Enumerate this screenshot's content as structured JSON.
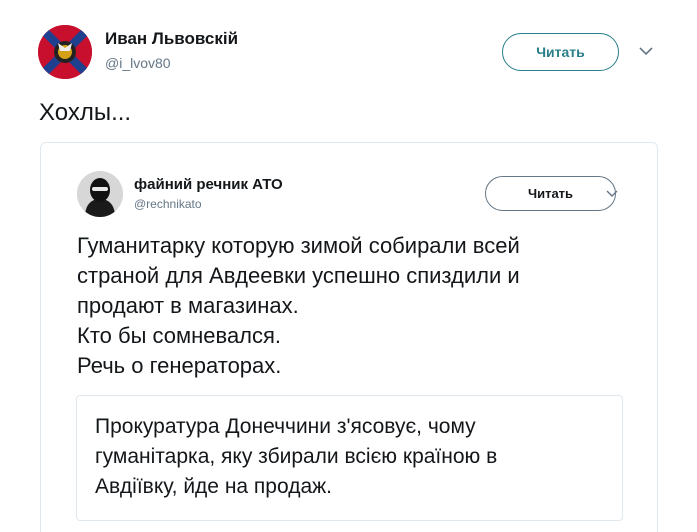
{
  "tweet": {
    "author_name": "Иван Львовскій",
    "author_handle": "@i_lvov80",
    "follow_label": "Читать",
    "text": "Хохлы..."
  },
  "quoted_tweet": {
    "author_name": "файний речник АТО",
    "author_handle": "@rechnikato",
    "follow_label": "Читать",
    "text_lines": [
      "Гуманитарку которую зимой собирали всей",
      "страной для Авдеевки успешно спиздили и",
      "продают в магазинах.",
      "Кто бы сомневался.",
      "Речь о генераторах."
    ],
    "link_card": {
      "title_lines": [
        "Прокуратура Донеччини з'ясовує, чому",
        "гуманітарка, яку збирали всією країною в",
        "Авдіївку, йде на продаж."
      ]
    }
  },
  "colors": {
    "follow_outer": "#2a7f8a",
    "secondary_text": "#657786",
    "border": "#e1e8ed"
  },
  "icons": {
    "outer_avatar": "flag-avatar-icon",
    "inner_avatar": "masked-person-avatar-icon",
    "menu": "chevron-down-icon"
  }
}
